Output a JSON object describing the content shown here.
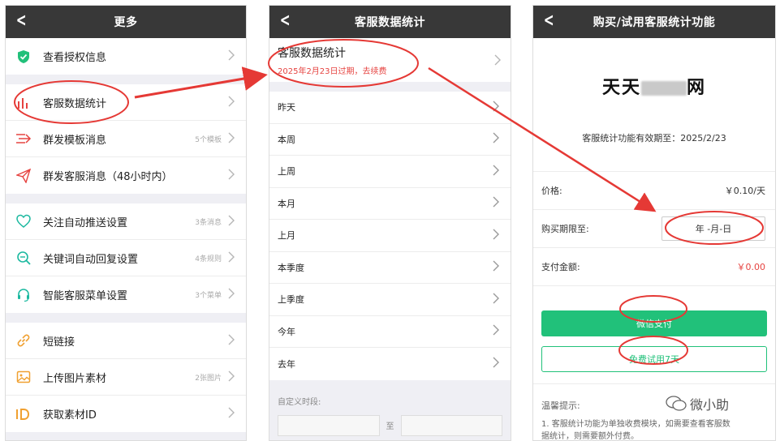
{
  "panel1": {
    "title": "更多",
    "groups": [
      [
        {
          "label": "查看授权信息",
          "hint": ""
        }
      ],
      [
        {
          "label": "客服数据统计",
          "hint": ""
        },
        {
          "label": "群发模板消息",
          "hint": "5个模板"
        },
        {
          "label": "群发客服消息（48小时内）",
          "hint": ""
        }
      ],
      [
        {
          "label": "关注自动推送设置",
          "hint": "3条消息"
        },
        {
          "label": "关键词自动回复设置",
          "hint": "4条规则"
        },
        {
          "label": "智能客服菜单设置",
          "hint": "3个菜单"
        }
      ],
      [
        {
          "label": "短链接",
          "hint": ""
        },
        {
          "label": "上传图片素材",
          "hint": "2张图片"
        },
        {
          "label": "获取素材ID",
          "hint": ""
        }
      ]
    ],
    "colors": {
      "green": "#22c07a",
      "red": "#e64340",
      "teal": "#1cb9a0",
      "orange": "#f0a030"
    }
  },
  "panel2": {
    "title": "客服数据统计",
    "head_title": "客服数据统计",
    "head_expiry": "2025年2月23日过期，去续费",
    "periods": [
      "昨天",
      "本周",
      "上周",
      "本月",
      "上月",
      "本季度",
      "上季度",
      "今年",
      "去年"
    ],
    "custom_label": "自定义时段:",
    "to_label": "至"
  },
  "panel3": {
    "title": "购买/试用客服统计功能",
    "brand_prefix": "天天",
    "brand_suffix": "网",
    "valid_until": "客服统计功能有效期至：2025/2/23",
    "price_label": "价格:",
    "price_value": "￥0.10/天",
    "period_label": "购买期限至:",
    "period_value": "年 -月-日",
    "amount_label": "支付金额:",
    "amount_value": "￥0.00",
    "pay_button": "微信支付",
    "trial_button": "免费试用7天",
    "tips_title": "温馨提示:",
    "tips_line1": "1. 客服统计功能为单独收费模块，如需要查看客服数",
    "tips_line2": "据统计，则需要额外付费。"
  },
  "watermark": "微小助"
}
